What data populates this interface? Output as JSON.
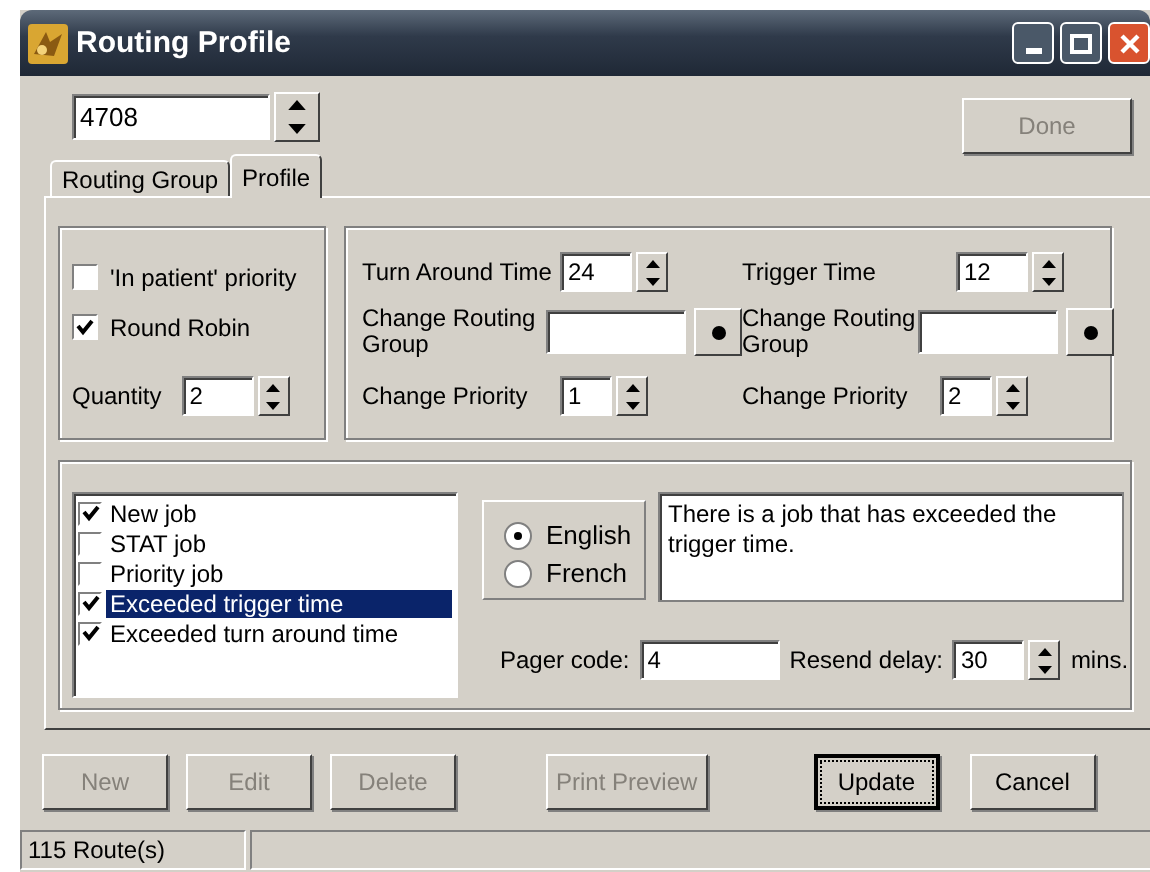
{
  "window": {
    "title": "Routing Profile"
  },
  "record_spinner": {
    "value": "4708"
  },
  "done_button": {
    "label": "Done",
    "disabled": true
  },
  "tabs": [
    {
      "label": "Routing Group",
      "selected": false
    },
    {
      "label": "Profile",
      "selected": true
    }
  ],
  "options": {
    "checkboxes": [
      {
        "label": "'In patient' priority",
        "checked": false
      },
      {
        "label": "Round Robin",
        "checked": true
      }
    ],
    "quantity": {
      "label": "Quantity",
      "value": "2"
    }
  },
  "timing_columns": [
    {
      "fields": [
        {
          "kind": "spin",
          "label": "Turn Around Time",
          "value": "24"
        },
        {
          "kind": "picker",
          "label": "Change Routing Group"
        },
        {
          "kind": "spin",
          "label": "Change Priority",
          "value": "1"
        }
      ]
    },
    {
      "fields": [
        {
          "kind": "spin",
          "label": "Trigger Time",
          "value": "12"
        },
        {
          "kind": "picker",
          "label": "Change Routing Group"
        },
        {
          "kind": "spin",
          "label": "Change Priority",
          "value": "2"
        }
      ]
    }
  ],
  "events": [
    {
      "label": "New job",
      "checked": true,
      "selected": false
    },
    {
      "label": "STAT job",
      "checked": false,
      "selected": false
    },
    {
      "label": "Priority job",
      "checked": false,
      "selected": false
    },
    {
      "label": "Exceeded trigger time",
      "checked": true,
      "selected": true
    },
    {
      "label": "Exceeded turn around time",
      "checked": true,
      "selected": false
    }
  ],
  "languages": [
    {
      "label": "English",
      "selected": true
    },
    {
      "label": "French",
      "selected": false
    }
  ],
  "message": {
    "value": "There is a job that has exceeded the trigger time."
  },
  "pager_code": {
    "label": "Pager code:",
    "value": "4"
  },
  "resend_delay": {
    "label": "Resend delay:",
    "value": "30",
    "unit": "mins."
  },
  "buttons": [
    {
      "label": "New",
      "disabled": true,
      "focused": false
    },
    {
      "label": "Edit",
      "disabled": true,
      "focused": false
    },
    {
      "label": "Delete",
      "disabled": true,
      "focused": false
    },
    {
      "label": "Print Preview",
      "disabled": true,
      "focused": false
    },
    {
      "label": "Update",
      "disabled": false,
      "focused": true
    },
    {
      "label": "Cancel",
      "disabled": false,
      "focused": false
    }
  ],
  "status_bar": {
    "panels": [
      "115 Route(s)"
    ]
  }
}
